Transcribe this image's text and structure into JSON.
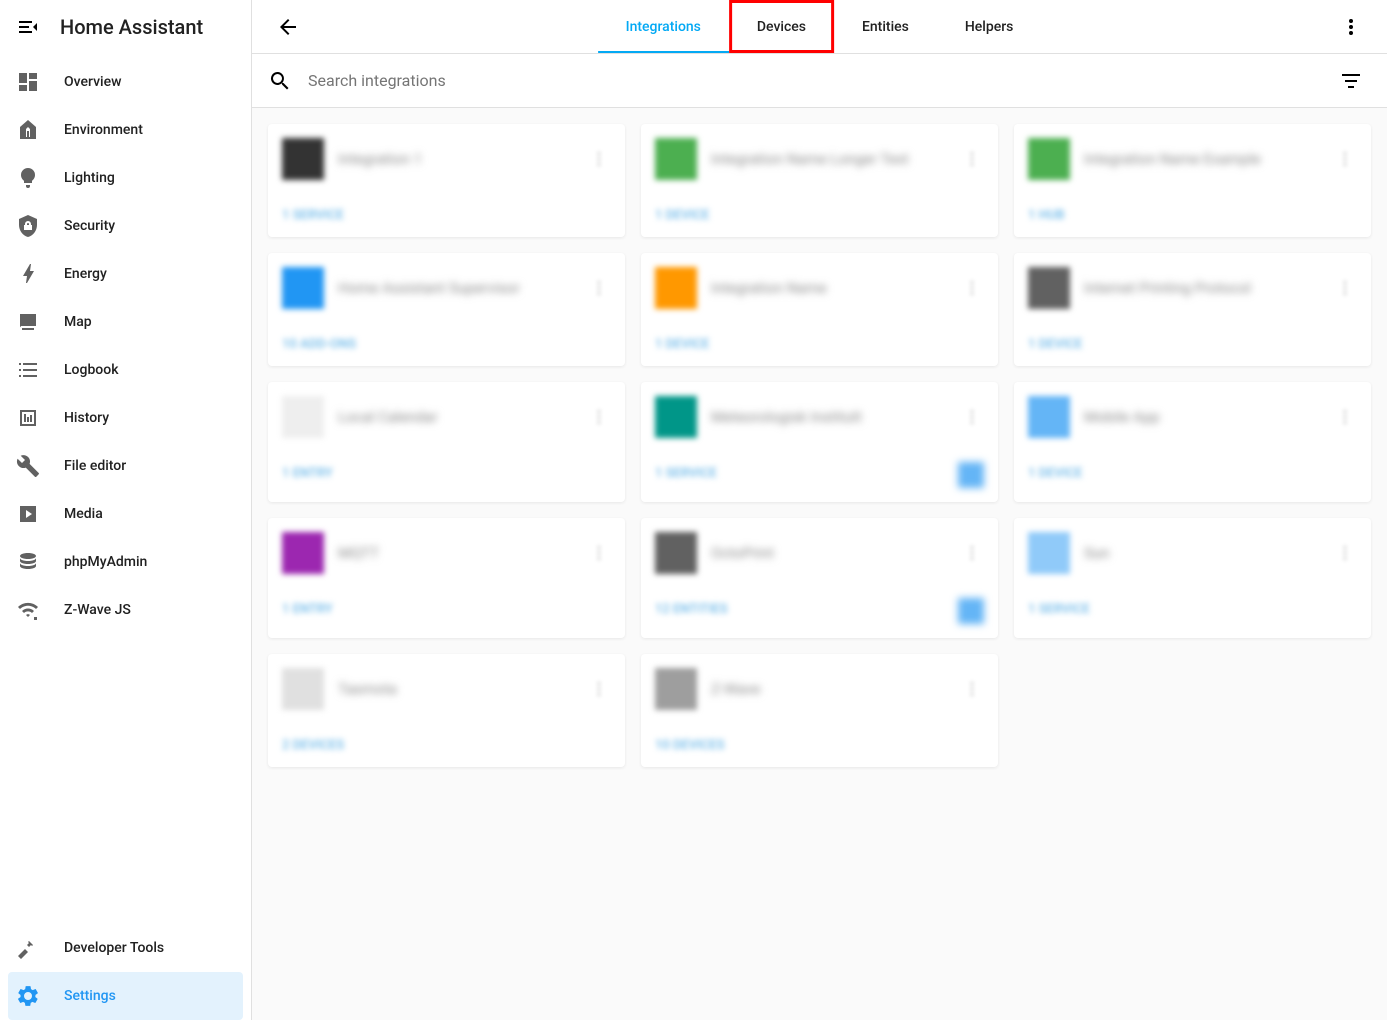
{
  "app": {
    "title": "Home Assistant"
  },
  "sidebar": {
    "items": [
      {
        "label": "Overview",
        "icon": "dashboard"
      },
      {
        "label": "Environment",
        "icon": "thermometer"
      },
      {
        "label": "Lighting",
        "icon": "lightbulb"
      },
      {
        "label": "Security",
        "icon": "shield"
      },
      {
        "label": "Energy",
        "icon": "flash"
      },
      {
        "label": "Map",
        "icon": "map"
      },
      {
        "label": "Logbook",
        "icon": "logbook"
      },
      {
        "label": "History",
        "icon": "history"
      },
      {
        "label": "File editor",
        "icon": "wrench"
      },
      {
        "label": "Media",
        "icon": "media"
      },
      {
        "label": "phpMyAdmin",
        "icon": "database"
      },
      {
        "label": "Z-Wave JS",
        "icon": "zwave"
      }
    ],
    "bottom": [
      {
        "label": "Developer Tools",
        "icon": "hammer"
      },
      {
        "label": "Settings",
        "icon": "cog",
        "active": true
      }
    ]
  },
  "tabs": [
    {
      "label": "Integrations",
      "active": true
    },
    {
      "label": "Devices",
      "highlighted": true
    },
    {
      "label": "Entities"
    },
    {
      "label": "Helpers"
    }
  ],
  "search": {
    "placeholder": "Search integrations"
  },
  "cards": [
    {
      "title": "Integration 1",
      "link": "1 SERVICE",
      "color": "#333"
    },
    {
      "title": "Integration Name Longer Text",
      "link": "1 DEVICE",
      "color": "#4caf50"
    },
    {
      "title": "Integration Name Example",
      "link": "1 HUB",
      "color": "#4caf50"
    },
    {
      "title": "Home Assistant Supervisor",
      "link": "10 ADD-ONS",
      "color": "#2196f3"
    },
    {
      "title": "Integration Name",
      "link": "1 DEVICE",
      "color": "#ff9800"
    },
    {
      "title": "Internet Printing Protocol",
      "link": "1 DEVICE",
      "color": "#616161"
    },
    {
      "title": "Local Calendar",
      "link": "1 ENTRY",
      "color": "#eeeeee"
    },
    {
      "title": "Meteorologisk Institutt",
      "link": "1 SERVICE",
      "color": "#009688",
      "badge": true
    },
    {
      "title": "Mobile App",
      "link": "1 DEVICE",
      "color": "#64b5f6"
    },
    {
      "title": "MQTT",
      "link": "1 ENTRY",
      "color": "#9c27b0"
    },
    {
      "title": "OctoPrint",
      "link": "12 ENTITIES",
      "color": "#616161",
      "badge": true
    },
    {
      "title": "Sun",
      "link": "1 SERVICE",
      "color": "#90caf9"
    },
    {
      "title": "Tasmota",
      "link": "2 DEVICES",
      "color": "#e0e0e0"
    },
    {
      "title": "Z-Wave",
      "link": "10 DEVICES",
      "color": "#9e9e9e"
    }
  ]
}
